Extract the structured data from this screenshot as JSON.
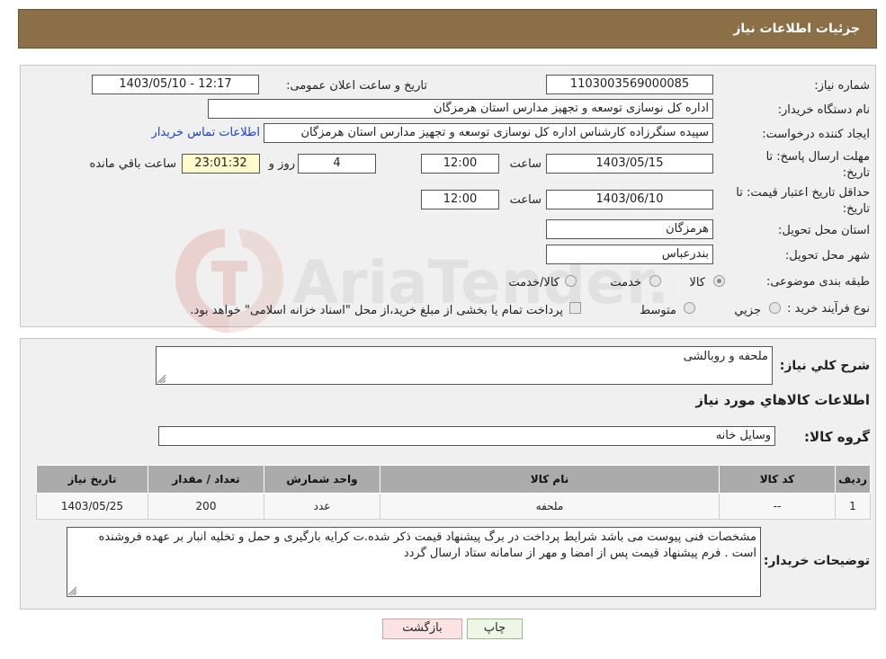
{
  "header": {
    "title": "جزئیات اطلاعات نیاز"
  },
  "form": {
    "need_number_label": "شماره نیاز:",
    "need_number": "1103003569000085",
    "announce_label": "تاریخ و ساعت اعلان عمومی:",
    "announce_value": "1403/05/10 - 12:17",
    "buyer_org_label": "نام دستگاه خریدار:",
    "buyer_org": "اداره کل نوسازی  توسعه و تجهیز مدارس استان هرمزگان",
    "creator_label": "ایجاد کننده درخواست:",
    "creator": "سپیده سنگرزاده کارشناس اداره کل نوسازی  توسعه و تجهیز مدارس استان هرمزگان",
    "contact_link": "اطلاعات تماس خریدار",
    "deadline_label_1": "مهلت ارسال پاسخ: تا",
    "deadline_label_2": "تاریخ:",
    "deadline_date": "1403/05/15",
    "time_label": "ساعت",
    "deadline_time": "12:00",
    "days": "4",
    "days_label": "روز و",
    "remaining": "23:01:32",
    "remaining_label": "ساعت باقي مانده",
    "validity_label_1": "حداقل تاریخ اعتبار قیمت: تا",
    "validity_label_2": "تاریخ:",
    "validity_date": "1403/06/10",
    "validity_time": "12:00",
    "province_label": "استان محل تحویل:",
    "province": "هرمزگان",
    "city_label": "شهر محل تحویل:",
    "city": "بندرعباس",
    "category_label": "طبقه بندی موضوعی:",
    "category_options": [
      "کالا",
      "خدمت",
      "کالا/خدمت"
    ],
    "process_label": "نوع فرآیند خرید :",
    "process_options": [
      "جزيي",
      "متوسط"
    ],
    "process_note": "پرداخت تمام یا بخشی از مبلغ خرید،از محل \"اسناد خزانه اسلامی\" خواهد بود."
  },
  "details": {
    "description_label": "شرح کلي نياز:",
    "description": "ملحفه و روبالشی",
    "goods_info_title": "اطلاعات کالاهاي مورد نياز",
    "goods_group_label": "گروه کالا:",
    "goods_group": "وسایل خانه",
    "table": {
      "headers": [
        "رديف",
        "کد کالا",
        "نام کالا",
        "واحد شمارش",
        "تعداد / مقدار",
        "تاريخ نياز"
      ],
      "rows": [
        [
          "1",
          "--",
          "ملحفه",
          "عدد",
          "200",
          "1403/05/25"
        ]
      ]
    },
    "buyer_notes_label": "توضيحات خريدار:",
    "buyer_notes": "مشخصات فنی پیوست می باشد شرایط پرداخت در برگ پیشنهاد قیمت ذکر شده.ت کرایه بارگیری و حمل و تخلیه انبار بر عهده فروشنده است . فرم پیشنهاد قیمت پس از امضا و مهر از سامانه ستاد ارسال گردد"
  },
  "buttons": {
    "print": "چاپ",
    "back": "بازگشت"
  },
  "watermark": {
    "text": "AriaTender.neT"
  },
  "colors": {
    "header_bg": "#8b6f47",
    "panel_bg": "#f0f0f0",
    "link": "#1a3fd1",
    "remaining_bg": "#fffbcc",
    "back_bg": "#fbe3e4",
    "print_bg": "#eef7e6"
  }
}
